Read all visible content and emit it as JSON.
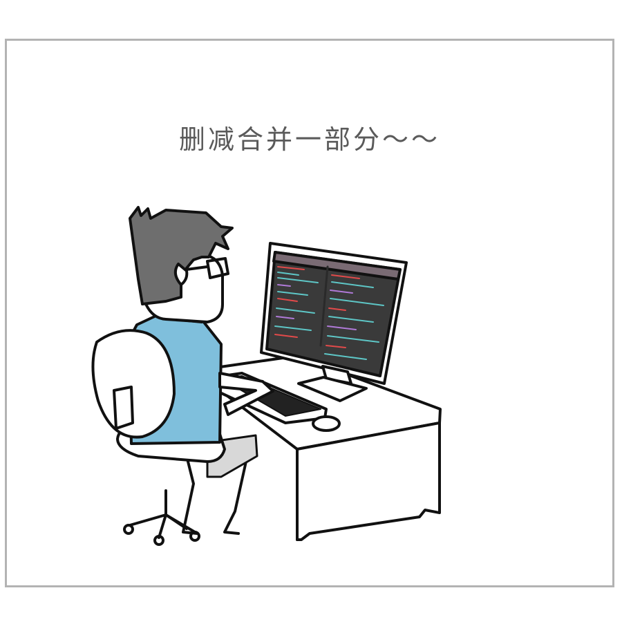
{
  "caption": "删减合并一部分～～",
  "colors": {
    "frame": "#b3b3b3",
    "shirt": "#7fbfdc",
    "hair": "#6e6e6e",
    "screen": "#3a3a3a",
    "outline": "#111111",
    "caption": "#5a5a5a"
  }
}
